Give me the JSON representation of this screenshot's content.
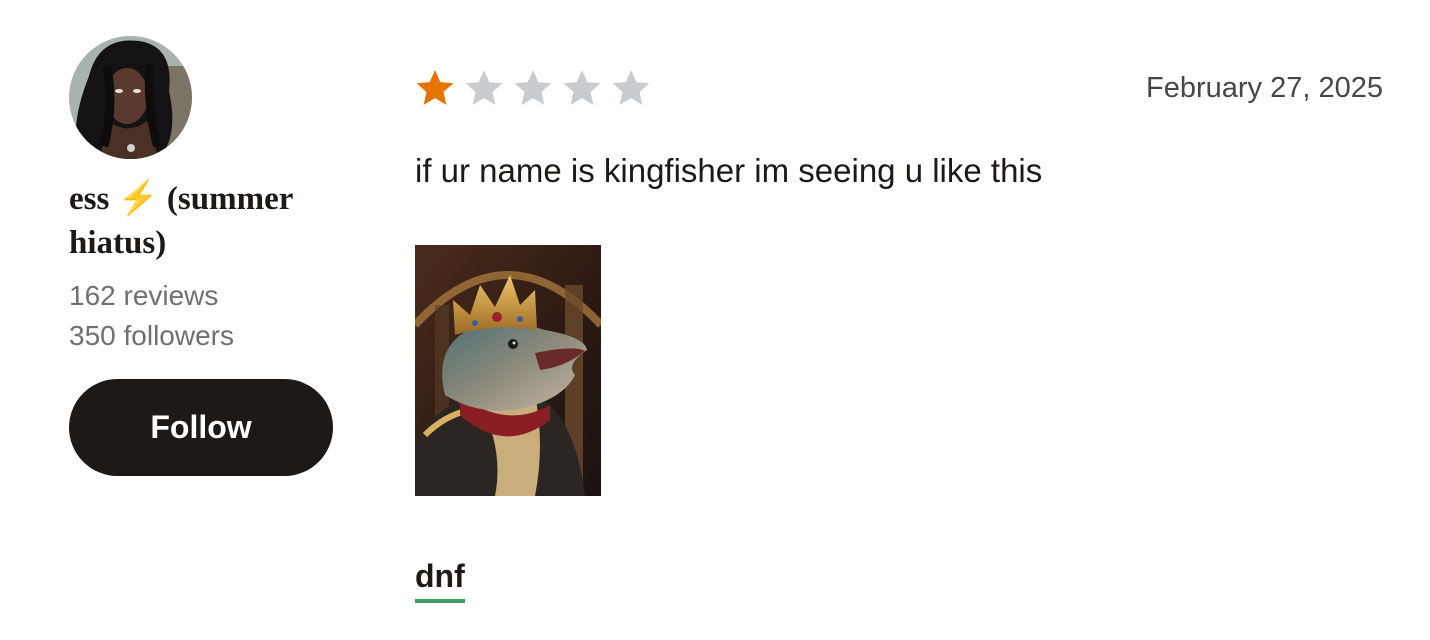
{
  "reviewer": {
    "avatar_icon": "user-avatar-photo",
    "name": "ess ⚡ (summer hiatus)",
    "reviews_count": "162 reviews",
    "followers_count": "350 followers",
    "follow_label": "Follow"
  },
  "review": {
    "rating": 1,
    "max_rating": 5,
    "date": "February 27, 2025",
    "text": "if ur name is kingfisher im seeing u like this",
    "image_icon": "crowned-fish-king-image",
    "shelf": "dnf"
  },
  "colors": {
    "star_filled": "#e87400",
    "star_empty": "#c7ccd1",
    "button_bg": "#1e1915",
    "shelf_underline": "#409d69",
    "muted_text": "#707070"
  }
}
